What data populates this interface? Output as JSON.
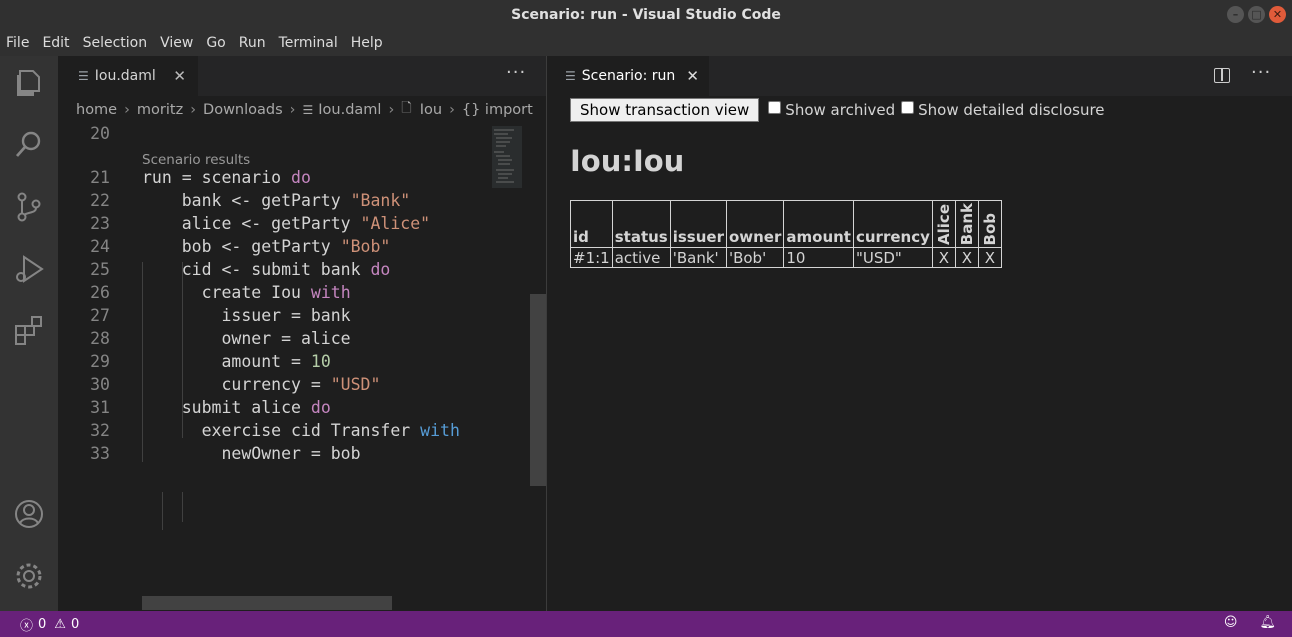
{
  "window": {
    "title": "Scenario: run - Visual Studio Code"
  },
  "menu": [
    "File",
    "Edit",
    "Selection",
    "View",
    "Go",
    "Run",
    "Terminal",
    "Help"
  ],
  "activity_icons": [
    "explorer-icon",
    "search-icon",
    "source-control-icon",
    "run-debug-icon",
    "extensions-icon",
    "accounts-icon",
    "manage-gear-icon"
  ],
  "left_editor": {
    "tab_label": "Iou.daml",
    "breadcrumb": [
      "home",
      "moritz",
      "Downloads",
      "Iou.daml",
      "Iou",
      "{} import"
    ],
    "codelens": "Scenario results",
    "lines": [
      {
        "n": "20",
        "code": ""
      },
      {
        "n": "21",
        "code": "run = scenario do"
      },
      {
        "n": "22",
        "code": "    bank <- getParty \"Bank\""
      },
      {
        "n": "23",
        "code": "    alice <- getParty \"Alice\""
      },
      {
        "n": "24",
        "code": "    bob <- getParty \"Bob\""
      },
      {
        "n": "25",
        "code": "    cid <- submit bank do"
      },
      {
        "n": "26",
        "code": "      create Iou with"
      },
      {
        "n": "27",
        "code": "        issuer = bank"
      },
      {
        "n": "28",
        "code": "        owner = alice"
      },
      {
        "n": "29",
        "code": "        amount = 10"
      },
      {
        "n": "30",
        "code": "        currency = \"USD\""
      },
      {
        "n": "31",
        "code": "    submit alice do"
      },
      {
        "n": "32",
        "code": "      exercise cid Transfer with"
      },
      {
        "n": "33",
        "code": "        newOwner = bob"
      }
    ]
  },
  "right_editor": {
    "tab_label": "Scenario: run",
    "button": "Show transaction view",
    "checkbox_archived": "Show archived",
    "checkbox_disclosure": "Show detailed disclosure",
    "heading": "Iou:Iou",
    "table": {
      "headers": [
        "id",
        "status",
        "issuer",
        "owner",
        "amount",
        "currency"
      ],
      "party_headers": [
        "Alice",
        "Bank",
        "Bob"
      ],
      "rows": [
        {
          "id": "#1:1",
          "status": "active",
          "issuer": "'Bank'",
          "owner": "'Bob'",
          "amount": "10",
          "currency": "\"USD\"",
          "alice": "X",
          "bank": "X",
          "bob": "X"
        }
      ]
    }
  },
  "statusbar": {
    "errors": "0",
    "warnings": "0",
    "color": "#68217a"
  }
}
